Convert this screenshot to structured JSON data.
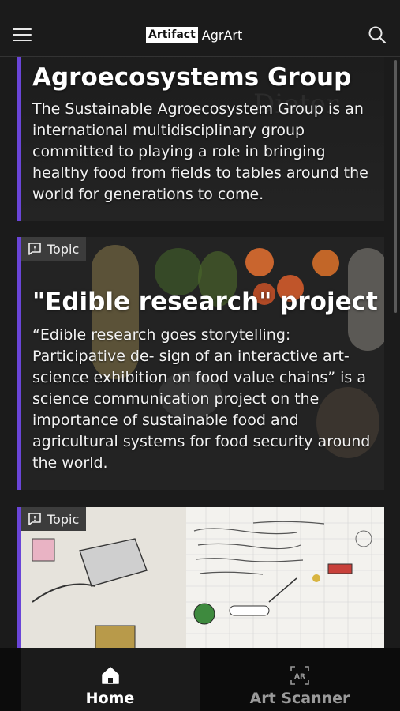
{
  "header": {
    "brand_box": "Artifact",
    "brand_text": "AgrArt",
    "menu_icon": "hamburger-menu-icon",
    "search_icon": "search-icon"
  },
  "cards": [
    {
      "title": "Agroecosystems Group",
      "description": "The Sustainable Agroecosystem Group is an international multidisciplinary group committed to playing a role in bringing healthy food from fields to tables around the world for generations to come."
    },
    {
      "badge": "Topic",
      "title": "\"Edible research\" project",
      "description": "“Edible research goes storytelling: Participative de- sign of an interactive art-science exhibition on food value chains” is a science communication project on the importance of sustainable food and agricultural systems for food security around the world."
    },
    {
      "badge": "Topic"
    }
  ],
  "bottom_nav": {
    "items": [
      {
        "label": "Home",
        "icon": "home-icon",
        "active": true
      },
      {
        "label": "Art Scanner",
        "icon": "ar-scanner-icon",
        "active": false
      }
    ]
  },
  "colors": {
    "accent": "#6a45d8",
    "background": "#1b1b1b",
    "nav_background": "#0c0c0c"
  }
}
